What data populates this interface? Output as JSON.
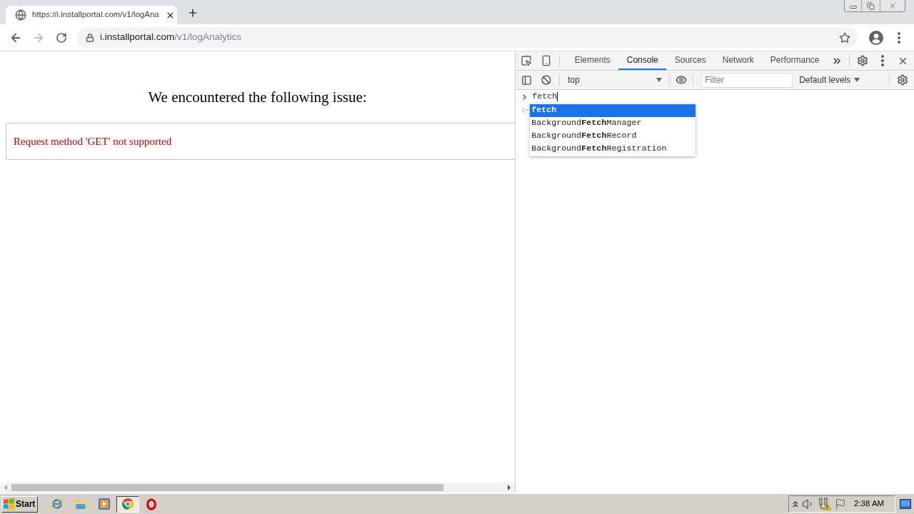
{
  "browser": {
    "tabs": [
      {
        "title": "https://i.installportal.com/v1/logAna",
        "selected": true
      }
    ],
    "navigation": {
      "back": {
        "disabled": false
      },
      "forward": {
        "disabled": true
      }
    },
    "address_bar": {
      "host": "i.installportal.com",
      "path": "/v1/logAnalytics"
    }
  },
  "page": {
    "heading": "We encountered the following issue:",
    "error_message": "Request method 'GET' not supported"
  },
  "devtools": {
    "panel_tabs": [
      {
        "label": "Elements",
        "selected": false
      },
      {
        "label": "Console",
        "selected": true
      },
      {
        "label": "Sources",
        "selected": false
      },
      {
        "label": "Network",
        "selected": false
      },
      {
        "label": "Performance",
        "selected": false
      }
    ],
    "console_toolbar": {
      "context": "top",
      "filter": {
        "placeholder": "Filter"
      },
      "levels": "Default levels"
    },
    "console": {
      "input": "fetch",
      "suggestions": [
        {
          "match": "fetch",
          "selected": true
        },
        {
          "before": "Background",
          "match": "Fetch",
          "after": "Manager",
          "selected": false
        },
        {
          "before": "Background",
          "match": "Fetch",
          "after": "Record",
          "selected": false
        },
        {
          "before": "Background",
          "match": "Fetch",
          "after": "Registration",
          "selected": false
        }
      ]
    }
  },
  "taskbar": {
    "start": "Start",
    "apps": [
      {
        "kind": "ie",
        "selected": false
      },
      {
        "kind": "explorer",
        "selected": false
      },
      {
        "kind": "media",
        "selected": false
      },
      {
        "kind": "chrome",
        "selected": true
      },
      {
        "kind": "opera",
        "selected": false
      }
    ],
    "clock": "2:38 AM"
  }
}
